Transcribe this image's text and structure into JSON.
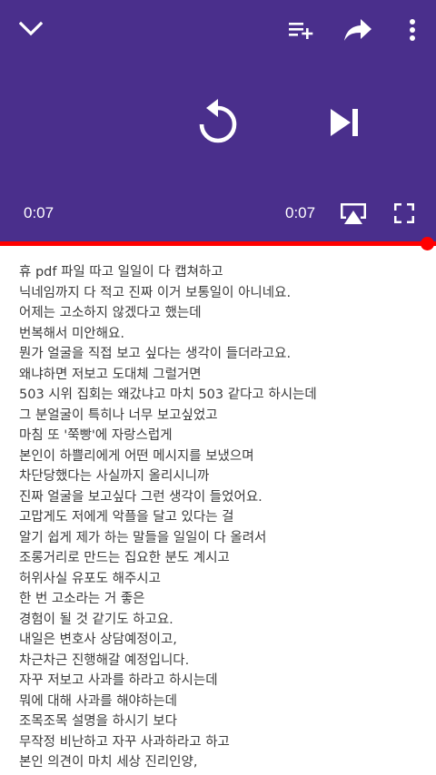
{
  "player": {
    "current_time": "0:07",
    "duration": "0:07",
    "progress": 1.0,
    "colors": {
      "background": "#4a2f8c",
      "progress": "#ff0000"
    },
    "icons": [
      "chevron-down-icon",
      "add-to-queue-icon",
      "share-icon",
      "more-vert-icon",
      "replay-icon",
      "skip-next-icon",
      "cast-icon",
      "fullscreen-icon"
    ]
  },
  "article": {
    "lines": [
      "휴 pdf 파일 따고 일일이 다 캡쳐하고",
      "닉네임까지 다 적고 진짜 이거 보통일이 아니네요.",
      "어제는 고소하지 않겠다고 했는데",
      "번복해서 미안해요.",
      "뭔가 얼굴을 직접 보고 싶다는 생각이 들더라고요.",
      "왜냐하면 저보고 도대체 그럴거면",
      "503 시위 집회는 왜갔냐고 마치 503 같다고 하시는데",
      "그 분얼굴이 특히나 너무 보고싶었고",
      "마침 또 '쭉빵'에 자랑스럽게",
      "본인이 하쁠리에게 어떤 메시지를 보냈으며",
      "차단당했다는 사실까지 올리시니까",
      "진짜 얼굴을 보고싶다 그런 생각이 들었어요.",
      "고맙게도 저에게 악플을 달고 있다는 걸",
      "알기 쉽게 제가 하는 말들을 일일이 다 올려서",
      "조롱거리로 만드는 집요한 분도 계시고",
      "허위사실 유포도 해주시고",
      "한 번 고소라는 거 좋은",
      "경험이 될 것 같기도 하고요.",
      "내일은 변호사 상담예정이고,",
      "차근차근 진행해갈 예정입니다.",
      "자꾸 저보고 사과를 하라고 하시는데",
      "뭐에 대해 사과를 해야하는데",
      "조목조목 설명을 하시기 보다",
      "무작정 비난하고 자꾸 사과하라고 하고",
      "본인 의견이 마치 세상 진리인양,"
    ]
  }
}
